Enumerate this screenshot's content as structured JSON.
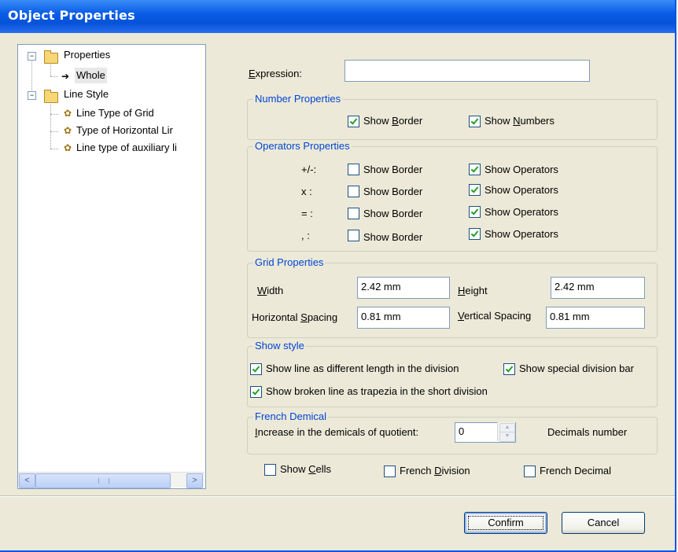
{
  "window": {
    "title": "Object Properties"
  },
  "tree": {
    "properties": "Properties",
    "whole": "Whole",
    "line_style": "Line Style",
    "grid_line": "Line Type of Grid",
    "horizontal_line": "Type of Horizontal Lir",
    "auxiliary_line": "Line type of auxiliary li",
    "expand_glyph": "−",
    "scroll_left": "<",
    "scroll_right": ">"
  },
  "expression": {
    "label_access": "E",
    "label_rest": "xpression:",
    "value": ""
  },
  "number_props": {
    "title": "Number Properties",
    "show_border_pre": "Show ",
    "show_border_access": "B",
    "show_border_post": "order",
    "show_border_checked": true,
    "show_numbers_pre": "Show ",
    "show_numbers_access": "N",
    "show_numbers_post": "umbers",
    "show_numbers_checked": true
  },
  "operators_props": {
    "title": "Operators Properties",
    "show_border_label": "Show Border",
    "show_operators_label": "Show Operators",
    "rows": [
      {
        "symbol": "+/-:",
        "border": false,
        "operators": true
      },
      {
        "symbol": "x :",
        "border": false,
        "operators": true
      },
      {
        "symbol": "= :",
        "border": false,
        "operators": true
      },
      {
        "symbol": ", :",
        "border": false,
        "operators": true
      }
    ]
  },
  "grid_props": {
    "title": "Grid Properties",
    "width_access": "W",
    "width_rest": "idth",
    "width_value": "2.42 mm",
    "height_access": "H",
    "height_rest": "eight",
    "height_value": "2.42 mm",
    "hspacing_pre": "Horizontal ",
    "hspacing_access": "S",
    "hspacing_post": "pacing",
    "hspacing_value": "0.81 mm",
    "vspacing_access": "V",
    "vspacing_rest": "ertical Spacing",
    "vspacing_value": "0.81 mm"
  },
  "show_style": {
    "title": "Show style",
    "different_length": "Show line as different length in the division",
    "different_length_checked": true,
    "special_bar": "Show special division bar",
    "special_bar_checked": true,
    "broken_line": "Show broken line as trapezia in the short division",
    "broken_line_checked": true
  },
  "french": {
    "title": "French Demical",
    "increase_access": "I",
    "increase_rest": "ncrease in the demicals of quotient:",
    "increase_value": "0",
    "decimals_label": "Decimals number",
    "spin_up": "▲",
    "spin_down": "▼"
  },
  "bottom_options": {
    "show_cells_pre": "Show ",
    "show_cells_access": "C",
    "show_cells_post": "ells",
    "show_cells_checked": false,
    "french_division_pre": "French ",
    "french_division_access": "D",
    "french_division_post": "ivision",
    "french_division_checked": false,
    "french_decimal": "French Decimal",
    "french_decimal_checked": false
  },
  "buttons": {
    "confirm": "Confirm",
    "cancel": "Cancel"
  }
}
